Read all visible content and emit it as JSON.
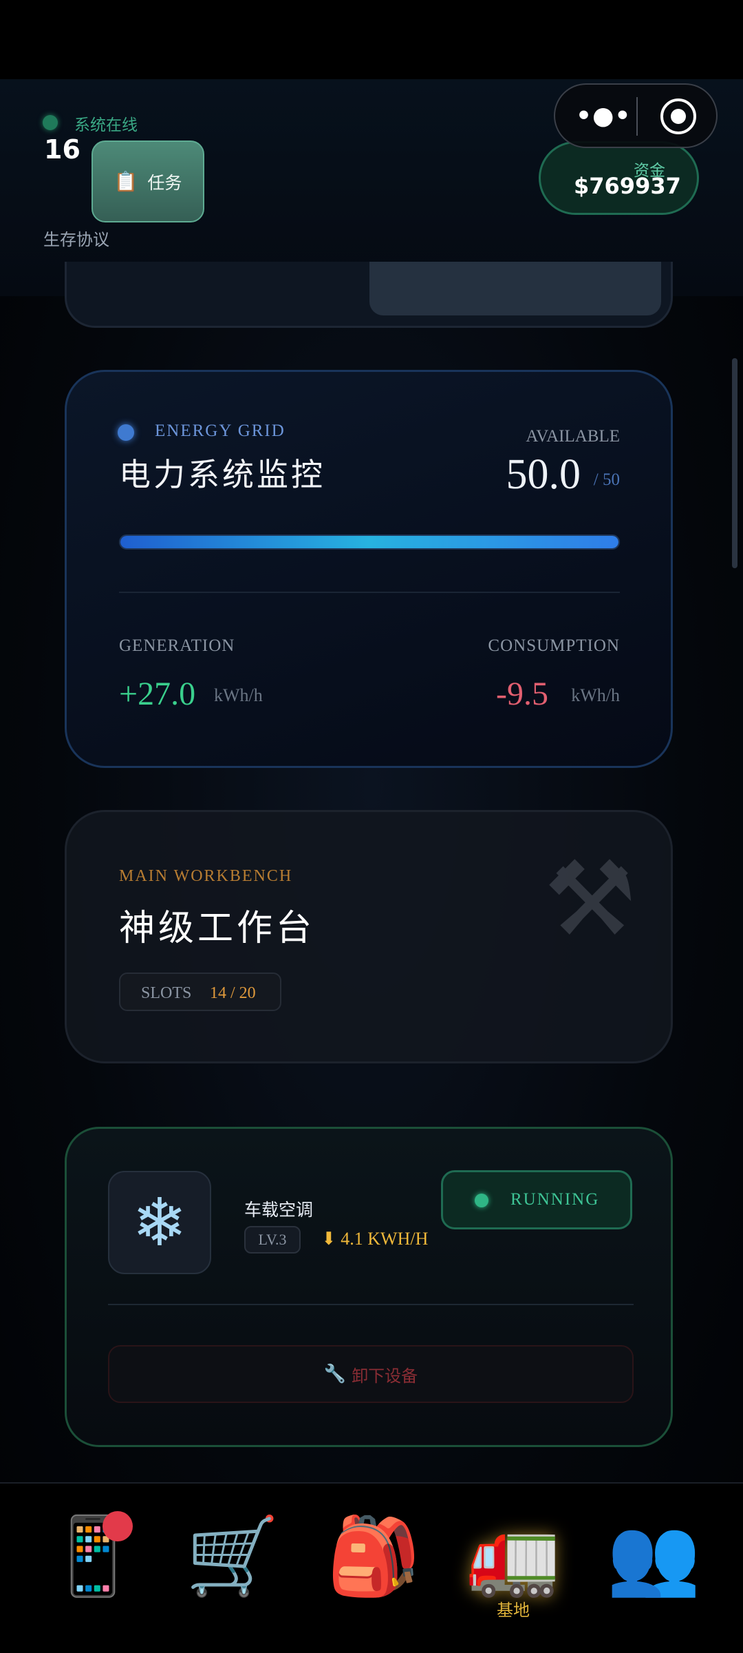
{
  "header": {
    "online_text": "系统在线",
    "day_count": "16",
    "protocol": "生存协议",
    "task_button": {
      "icon": "clipboard-icon",
      "label": "任务"
    },
    "funds": {
      "label": "资金",
      "value": "$769937"
    },
    "capsule": {
      "more_icon": "more-dots-icon",
      "close_icon": "target-close-icon"
    }
  },
  "energy": {
    "tag": "ENERGY GRID",
    "title": "电力系统监控",
    "available_label": "AVAILABLE",
    "available_value": "50.0",
    "available_max": "/ 50",
    "progress_fraction": 1.0,
    "generation_label": "GENERATION",
    "generation_value": "+27.0",
    "generation_unit": "kWh/h",
    "consumption_label": "CONSUMPTION",
    "consumption_value": "-9.5",
    "consumption_unit": "kWh/h",
    "colors": {
      "generation": "#3ad08d",
      "consumption": "#e25f70"
    }
  },
  "workbench": {
    "tag": "MAIN WORKBENCH",
    "title": "神级工作台",
    "slots_label": "SLOTS",
    "slots_value": "14 / 20",
    "bg_icon": "hammer-wrench-icon"
  },
  "device": {
    "icon": "snowflake-icon",
    "name": "车载空调",
    "level": "LV.3",
    "power": "⬇ 4.1 KWH/H",
    "status": "RUNNING",
    "unmount_icon": "wrench-icon",
    "unmount_label": "卸下设备"
  },
  "nav": {
    "items": [
      {
        "icon": "phone-icon",
        "badge": true
      },
      {
        "icon": "cart-icon"
      },
      {
        "icon": "backpack-icon"
      },
      {
        "icon": "truck-icon",
        "label": "基地",
        "active": true
      },
      {
        "icon": "people-icon"
      }
    ]
  }
}
